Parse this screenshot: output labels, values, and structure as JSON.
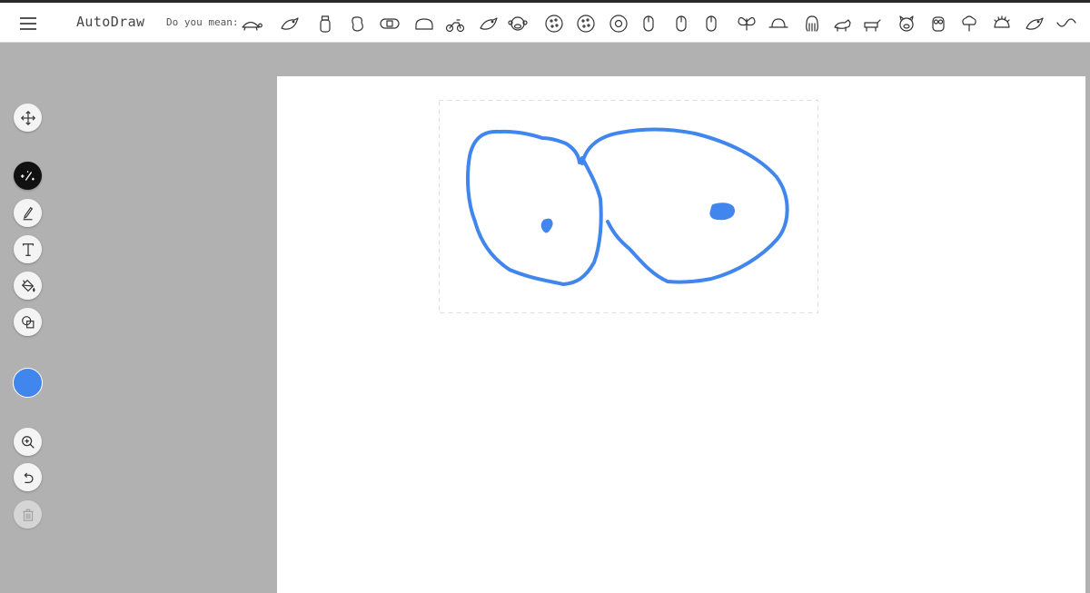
{
  "app": {
    "title": "AutoDraw"
  },
  "suggestions_bar": {
    "label": "Do you mean:",
    "items": [
      "turtle",
      "bird",
      "jar",
      "peanut",
      "bandage",
      "bread",
      "motorcycle",
      "bird",
      "monkey",
      "cookie",
      "cookie",
      "donut",
      "mouse",
      "mouse",
      "mouse",
      "butterfly",
      "hat",
      "octopus",
      "cat",
      "dog",
      "pig",
      "owl",
      "broccoli",
      "hedgehog",
      "bird",
      "wave"
    ]
  },
  "toolbar": {
    "tools": [
      "select",
      "autodraw",
      "draw",
      "type",
      "fill",
      "shape"
    ],
    "active_tool": "autodraw",
    "actions": [
      "zoom",
      "undo",
      "delete"
    ]
  },
  "colors": {
    "current_color": "#4186ed",
    "stroke_color": "#4186ed",
    "topbar_bg": "#ffffff",
    "workspace_bg": "#b1b1b1"
  }
}
